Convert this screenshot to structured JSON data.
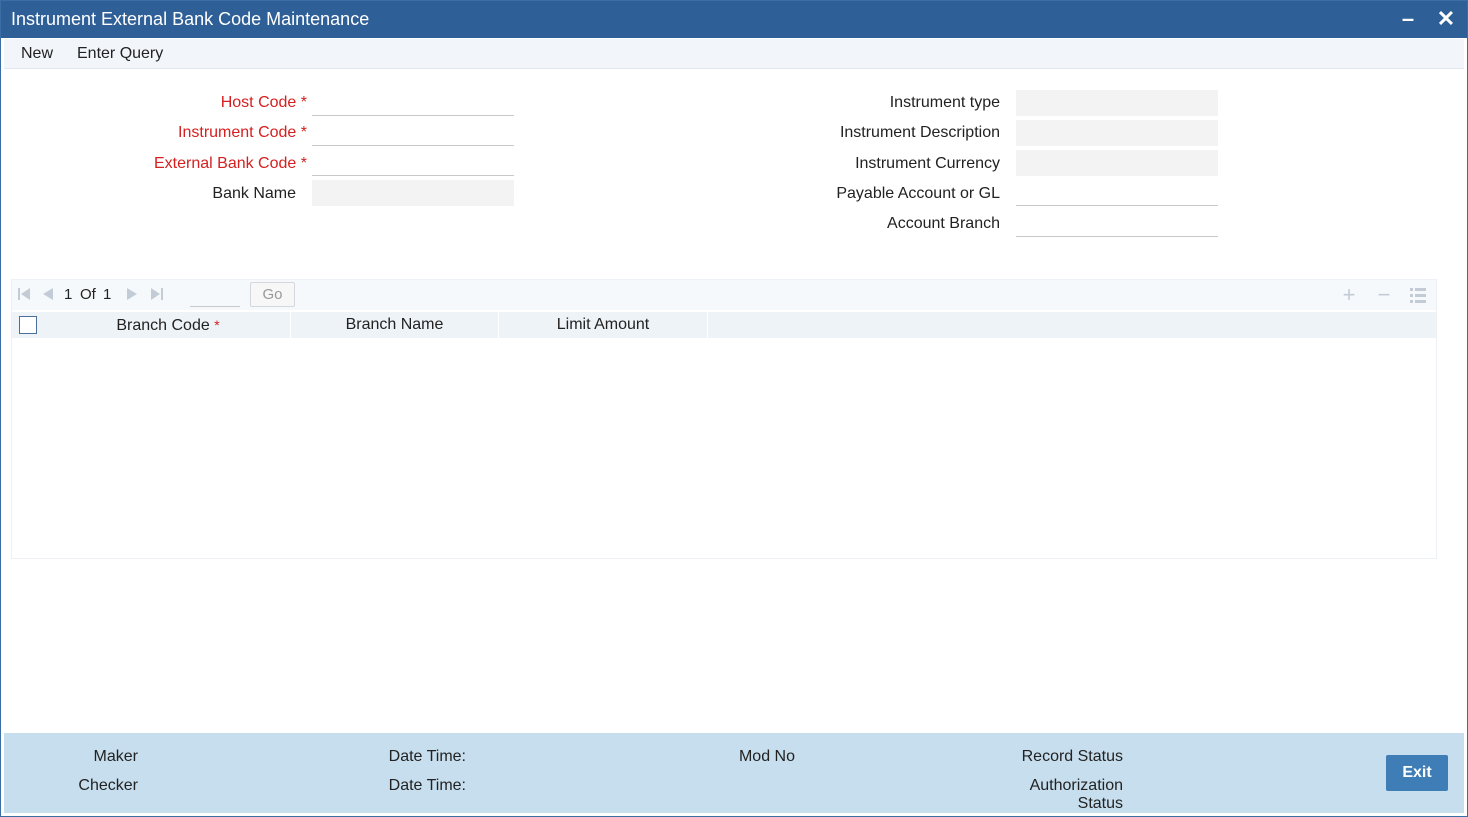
{
  "window": {
    "title": "Instrument External Bank Code Maintenance"
  },
  "menu": {
    "new_label": "New",
    "enter_query_label": "Enter Query"
  },
  "form": {
    "host_code": {
      "label": "Host Code",
      "required_mark": "*",
      "value": ""
    },
    "instrument_code": {
      "label": "Instrument Code",
      "required_mark": "*",
      "value": ""
    },
    "external_bank_code": {
      "label": "External Bank Code",
      "required_mark": "*",
      "value": ""
    },
    "bank_name": {
      "label": "Bank Name",
      "value": ""
    },
    "instrument_type": {
      "label": "Instrument type",
      "value": ""
    },
    "instrument_description": {
      "label": "Instrument Description",
      "value": ""
    },
    "instrument_currency": {
      "label": "Instrument Currency",
      "value": ""
    },
    "payable_account": {
      "label": "Payable Account or GL",
      "value": ""
    },
    "account_branch": {
      "label": "Account Branch",
      "value": ""
    }
  },
  "grid": {
    "pager": {
      "current": "1",
      "of_label": "Of",
      "total": "1",
      "go_label": "Go"
    },
    "columns": [
      {
        "label": "Branch Code",
        "required_mark": "*"
      },
      {
        "label": "Branch Name"
      },
      {
        "label": "Limit Amount"
      }
    ],
    "rows": []
  },
  "footer": {
    "maker_label": "Maker",
    "checker_label": "Checker",
    "date_time_label_1": "Date Time:",
    "date_time_label_2": "Date Time:",
    "mod_no_label": "Mod No",
    "record_status_label": "Record Status",
    "authorization_label_line1": "Authorization",
    "authorization_label_line2": "Status",
    "exit_label": "Exit"
  },
  "colors": {
    "titlebar": "#2f5f97",
    "required": "#d42020",
    "footer": "#c7deee",
    "exit_button": "#3e7db5"
  }
}
